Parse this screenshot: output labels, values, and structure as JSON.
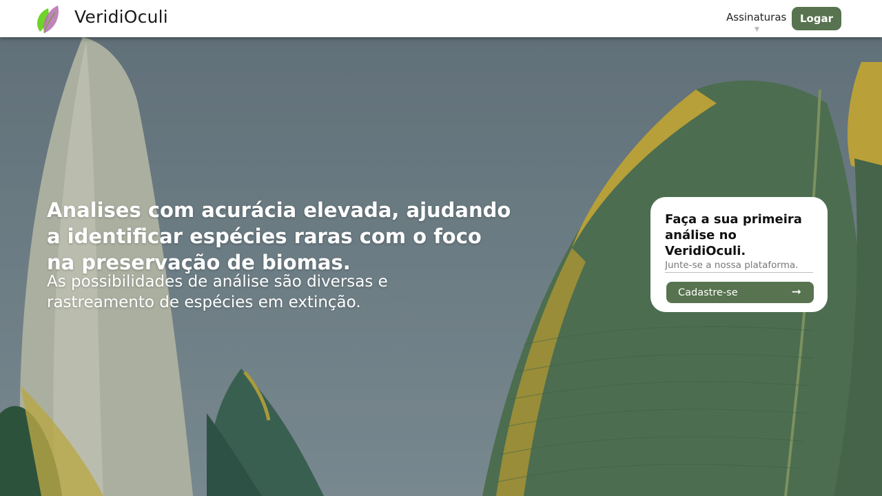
{
  "header": {
    "brand_name": "VeridiOculi",
    "nav_subscriptions_label": "Assinaturas",
    "nav_caret": "▼",
    "login_label": "Logar"
  },
  "hero": {
    "headline": "Analises com acurácia elevada, ajudando a identificar espécies raras com o foco na preservação de biomas.",
    "subline": "As possibilidades de análise são diversas e rastreamento de espécies em extinção."
  },
  "signup_card": {
    "title": "Faça a sua primeira análise no VeridiOculi.",
    "input_placeholder": "Junte-se a nossa plataforma.",
    "cta_label": "Cadastre-se",
    "cta_icon": "arrow-right-icon"
  },
  "colors": {
    "brand_green": "#58734f",
    "navbar_bg": "#ffffff",
    "card_bg": "#ffffff"
  }
}
